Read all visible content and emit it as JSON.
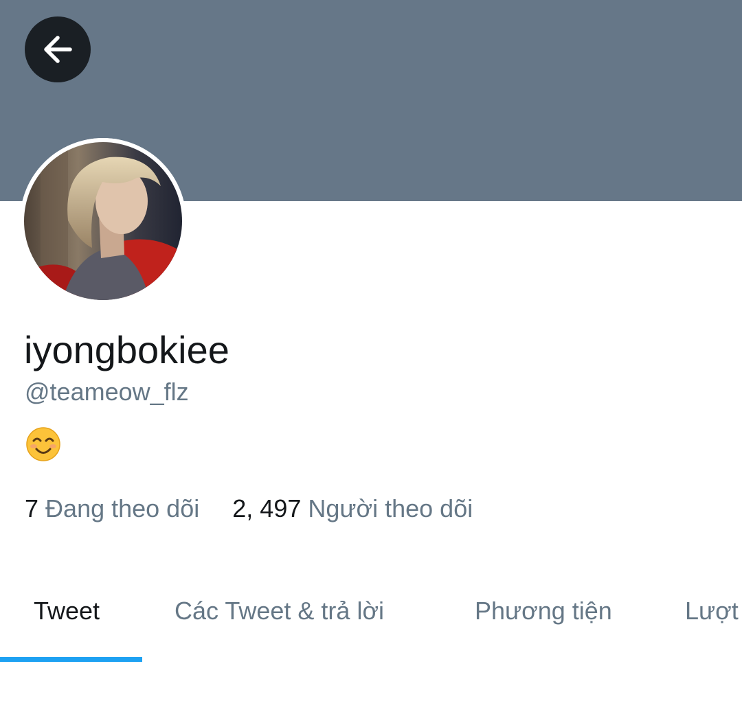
{
  "profile": {
    "display_name": "iyongbokiee",
    "handle": "@teameow_flz",
    "bio_emoji": "smiling-face-with-smiling-eyes-icon"
  },
  "stats": {
    "following_count": "7",
    "following_label": "Đang theo dõi",
    "followers_count": "2, 497",
    "followers_label": "Người theo dõi"
  },
  "tabs": [
    {
      "label": "Tweet",
      "active": true
    },
    {
      "label": "Các Tweet & trả lời",
      "active": false
    },
    {
      "label": "Phương tiện",
      "active": false
    },
    {
      "label": "Lượt",
      "active": false
    }
  ],
  "colors": {
    "banner": "#667788",
    "accent": "#1da1f2",
    "secondary_text": "#657786",
    "primary_text": "#14171a"
  }
}
